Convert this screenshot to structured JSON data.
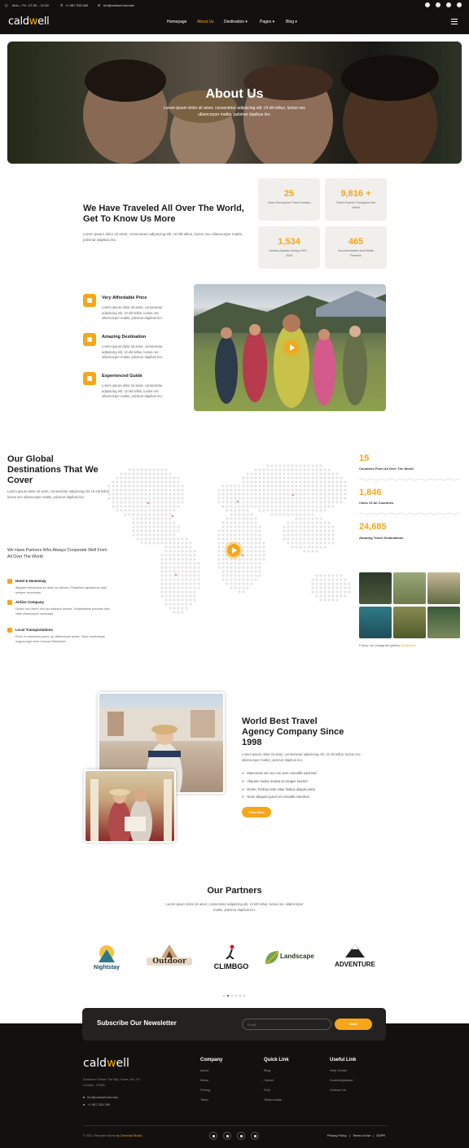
{
  "topbar": {
    "hours": "Mon – Fri : 07.00 – 21.00",
    "phone": "+1 987.333.289",
    "email": "hlo@caldwell.domain"
  },
  "brand": {
    "name_a": "cald",
    "name_o": "w",
    "name_b": "ell"
  },
  "nav": {
    "items": [
      "Homepage",
      "About Us",
      "Destination ▾",
      "Pages ▾",
      "Blog ▾"
    ],
    "active": "About Us"
  },
  "hero": {
    "title": "About Us",
    "subtitle": "Lorem ipsum dolor sit amet, consectetur adipiscing elit. Ut elit tellus, luctus nec ullamcorper mattis, pulvinar dapibus leo."
  },
  "about": {
    "title": "We Have Traveled All Over The World, Get To Know Us More",
    "text": "Lorem ipsum dolor sit amet, consectetur adipiscing elit. Ut elit tellus, luctus nec ullamcorper mattis, pulvinar dapibus leo.",
    "stats": [
      {
        "number": "25",
        "label": "Years Serving the Travel Industry"
      },
      {
        "number": "9,816 +",
        "label": "Travel Experts Throughout the World"
      },
      {
        "number": "1,534",
        "label": "Industry Awards During 1997 – 2018"
      },
      {
        "number": "465",
        "label": "Accommodation and Media Partners"
      }
    ]
  },
  "features": [
    {
      "title": "Very Affordable Price",
      "text": "Lorem ipsum dolor sit amet, consectetur adipiscing elit. Ut elit tellus, luctus nec ullamcorper mattis, pulvinar dapibus leo.",
      "icon": "wallet-icon"
    },
    {
      "title": "Amazing Destination",
      "text": "Lorem ipsum dolor sit amet, consectetur adipiscing elit. Ut elit tellus, luctus nec ullamcorper mattis, pulvinar dapibus leo.",
      "icon": "location-icon"
    },
    {
      "title": "Experienced Guide",
      "text": "Lorem ipsum dolor sit amet, consectetur adipiscing elit. Ut elit tellus, luctus nec ullamcorper mattis, pulvinar dapibus leo.",
      "icon": "star-icon"
    }
  ],
  "destinations": {
    "title": "Our Global Destinations That We Cover",
    "text": "Lorem ipsum dolor sit amet, consectetur adipiscing elit. Ut elit tellus, luctus nec ullamcorper mattis, pulvinar dapibus leo.",
    "partner_line": "We Have Partners Who Always Cooperate Well From All Over The World",
    "services": [
      {
        "title": "Hotel & Homestay",
        "text": "Aliquam fermentum ex diam ac ultrices. Phasellus egestas at nulla semper accumsan",
        "icon": "hotel-icon"
      },
      {
        "title": "Airline Company",
        "text": "Donec non libero non leo tristique laoreet. Suspendisse pulvinar nibh vitae ullamcorper venenatis.",
        "icon": "plane-icon"
      },
      {
        "title": "Local Transportations",
        "text": "Proin in commodo purus, ac ullamcorper quam. Nunc scelerisque magna eget enim rhoncus bibendum",
        "icon": "bus-icon"
      }
    ],
    "stats": [
      {
        "number": "15",
        "label": "Countries From All Over The World"
      },
      {
        "number": "1,846",
        "label": "Cities Of All Countries"
      },
      {
        "number": "24,685",
        "label": "Amazing Travel Destinations"
      }
    ],
    "instagram_text": "Follow our instagram gallery",
    "instagram_handle": "@caldwell"
  },
  "world_best": {
    "title": "World Best Travel Agency Company Since 1998",
    "text": "Lorem ipsum dolor sit amet, consectetur adipiscing elit. Ut elit tellus, luctus nec ullamcorper mattis, pulvinar dapibus leo.",
    "checks": [
      "Maecenas vel orci non sem convallis euismod",
      "Aliquam luctus massa at congue laoreet",
      "Donec Finibus ante vitae finibus aliquet porta",
      "Nunc aliquam purus et convallis interdum"
    ],
    "button": "View More"
  },
  "partners": {
    "title": "Our Partners",
    "text": "Lorem ipsum dolor sit amet, consectetur adipiscing elit. Ut elit tellus, luctus nec ullamcorper mattis, pulvinar dapibus leo.",
    "logos": [
      "Nightstay",
      "Outdoor",
      "CLIMBGO",
      "Landscape",
      "ADVENTURE"
    ]
  },
  "newsletter": {
    "title": "Subscribe Our Newsletter",
    "placeholder": "Email",
    "button": "Send"
  },
  "footer": {
    "address": "Sunshine Street The Sky Tower, No. F2, London, 47385",
    "email": "hlo@caldwell.domain",
    "phone": "+1 987.333.289",
    "columns": [
      {
        "title": "Company",
        "links": [
          "About",
          "News",
          "Pricing",
          "Team"
        ]
      },
      {
        "title": "Quick Link",
        "links": [
          "Blog",
          "Career",
          "FAQ",
          "Testimonials"
        ]
      },
      {
        "title": "Useful Link",
        "links": [
          "Help Center",
          "Knowledgebase",
          "Contact Us"
        ]
      }
    ],
    "copyright": "© 2021 Template Name ",
    "studio": "by Dexvtual Studio",
    "legal": [
      "Privacy Policy",
      "|",
      "Terms of Use",
      "|",
      "GDPR"
    ]
  },
  "colors": {
    "accent": "#f6a619",
    "dark": "#131110"
  }
}
